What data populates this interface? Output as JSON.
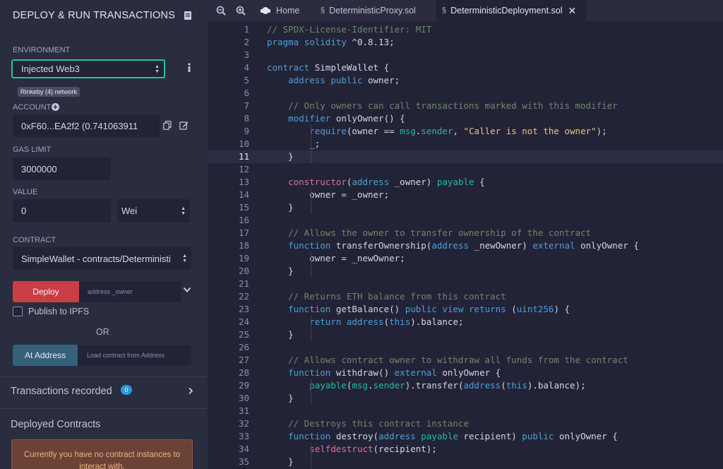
{
  "panel": {
    "title": "DEPLOY & RUN TRANSACTIONS",
    "environment_label": "ENVIRONMENT",
    "environment_value": "Injected Web3",
    "network_badge": "Rinkeby (4) network",
    "account_label": "ACCOUNT",
    "account_value": "0xF60...EA2f2 (0.741063911",
    "gas_limit_label": "GAS LIMIT",
    "gas_limit_value": "3000000",
    "value_label": "VALUE",
    "value_amount": "0",
    "value_unit": "Wei",
    "contract_label": "CONTRACT",
    "contract_value": "SimpleWallet - contracts/Deterministi",
    "deploy_label": "Deploy",
    "deploy_arg_placeholder": "address _owner",
    "publish_label": "Publish to IPFS",
    "or_label": "OR",
    "at_address_label": "At Address",
    "at_address_placeholder": "Load contract from Address",
    "transactions_label": "Transactions recorded",
    "transactions_count": "0",
    "deployed_label": "Deployed Contracts",
    "no_contracts_msg": "Currently you have no contract instances to interact with."
  },
  "tabs": [
    {
      "label": "Home",
      "icon": "remix-logo-icon",
      "active": false
    },
    {
      "label": "DeterministicProxy.sol",
      "icon": "solidity-file-icon",
      "active": false
    },
    {
      "label": "DeterministicDeployment.sol",
      "icon": "solidity-file-icon",
      "active": true
    }
  ],
  "editor": {
    "current_line": 11,
    "lines": [
      "// SPDX-License-Identifier: MIT",
      "pragma solidity ^0.8.13;",
      "",
      "contract SimpleWallet {",
      "    address public owner;",
      "",
      "    // Only owners can call transactions marked with this modifier",
      "    modifier onlyOwner() {",
      "        require(owner == msg.sender, \"Caller is not the owner\");",
      "        _;",
      "    }",
      "",
      "    constructor(address _owner) payable {",
      "        owner = _owner;",
      "    }",
      "",
      "    // Allows the owner to transfer ownership of the contract",
      "    function transferOwnership(address _newOwner) external onlyOwner {",
      "        owner = _newOwner;",
      "    }",
      "",
      "    // Returns ETH balance from this contract",
      "    function getBalance() public view returns (uint256) {",
      "        return address(this).balance;",
      "    }",
      "",
      "    // Allows contract owner to withdraw all funds from the contract",
      "    function withdraw() external onlyOwner {",
      "        payable(msg.sender).transfer(address(this).balance);",
      "    }",
      "",
      "    // Destroys this contract instance",
      "    function destroy(address payable recipient) public onlyOwner {",
      "        selfdestruct(recipient);",
      "    }",
      "}"
    ]
  },
  "colors": {
    "accent_green": "#1fc6a1",
    "deploy_red": "#c93d46",
    "at_address_blue": "#35607a",
    "badge_blue": "#2c9ad6"
  }
}
